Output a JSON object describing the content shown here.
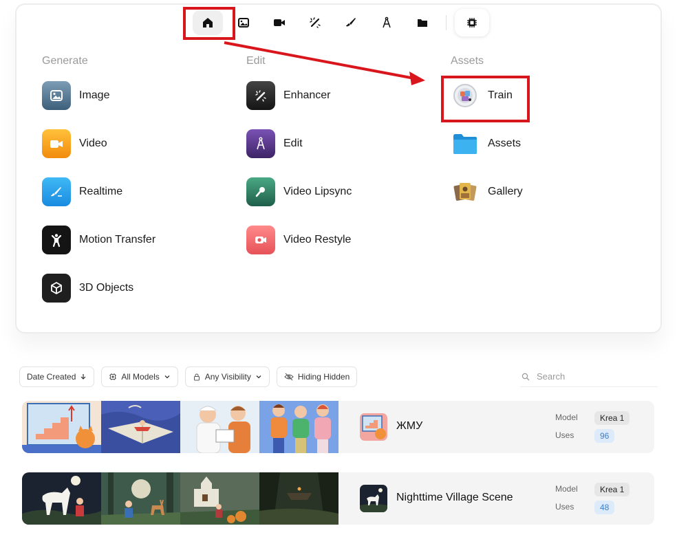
{
  "toolbar": {
    "buttons": [
      {
        "icon": "home-icon"
      },
      {
        "icon": "image-icon"
      },
      {
        "icon": "video-icon"
      },
      {
        "icon": "magic-wand-icon"
      },
      {
        "icon": "brush-icon"
      },
      {
        "icon": "compass-icon"
      },
      {
        "icon": "folder-icon"
      },
      {
        "icon": "chip-icon"
      }
    ]
  },
  "menu": {
    "generate": {
      "title": "Generate",
      "items": [
        {
          "label": "Image",
          "color": "#5b7f9c"
        },
        {
          "label": "Video",
          "color": "#f6a61c"
        },
        {
          "label": "Realtime",
          "color": "#29a3ea"
        },
        {
          "label": "Motion Transfer",
          "color": "#141414"
        },
        {
          "label": "3D Objects",
          "color": "#1f1f1f"
        }
      ]
    },
    "edit": {
      "title": "Edit",
      "items": [
        {
          "label": "Enhancer",
          "color": "#2a2a2a"
        },
        {
          "label": "Edit",
          "color": "#5d3a8c"
        },
        {
          "label": "Video Lipsync",
          "color": "#2f8b6e"
        },
        {
          "label": "Video Restyle",
          "color": "#f0676a"
        }
      ]
    },
    "assets": {
      "title": "Assets",
      "items": [
        {
          "label": "Train"
        },
        {
          "label": "Assets",
          "color": "#2ea3e8"
        },
        {
          "label": "Gallery"
        }
      ]
    }
  },
  "filters": {
    "sort": "Date Created",
    "models": "All Models",
    "visibility": "Any Visibility",
    "hidden": "Hiding Hidden",
    "search_placeholder": "Search"
  },
  "rows": [
    {
      "title": "ЖМУ",
      "model_label": "Model",
      "model": "Krea 1",
      "uses_label": "Uses",
      "uses": "96"
    },
    {
      "title": "Nighttime Village Scene",
      "model_label": "Model",
      "model": "Krea 1",
      "uses_label": "Uses",
      "uses": "48"
    }
  ],
  "annotation_color": "#d9161b"
}
